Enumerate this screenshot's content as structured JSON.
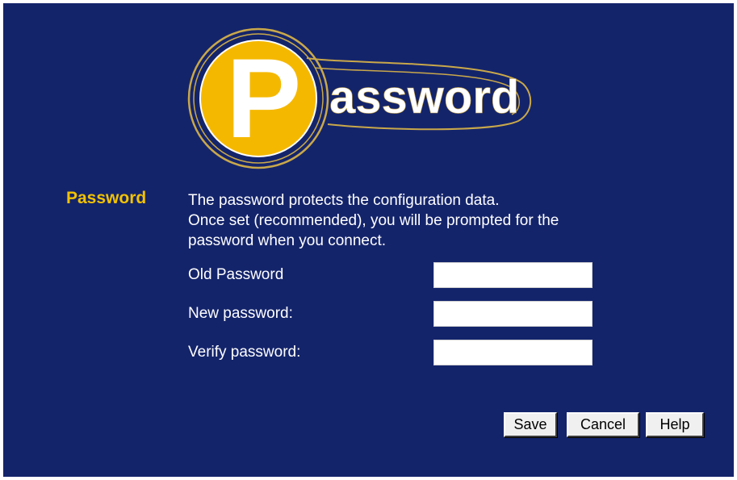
{
  "logo": {
    "letter": "P",
    "word": "assword"
  },
  "section": {
    "label": "Password",
    "description_lines": [
      "The password protects the configuration data.",
      "Once set (recommended), you will be prompted for the",
      "password when you connect."
    ]
  },
  "form": {
    "fields": [
      {
        "label": "Old Password",
        "value": "",
        "placeholder": ""
      },
      {
        "label": "New password:",
        "value": "",
        "placeholder": ""
      },
      {
        "label": "Verify password:",
        "value": "",
        "placeholder": ""
      }
    ]
  },
  "buttons": {
    "save": "Save",
    "cancel": "Cancel",
    "help": "Help"
  },
  "colors": {
    "background": "#14246b",
    "accent": "#f2c200",
    "text": "#ffffff"
  },
  "icons": {
    "logo": "password-p-logo-icon"
  }
}
